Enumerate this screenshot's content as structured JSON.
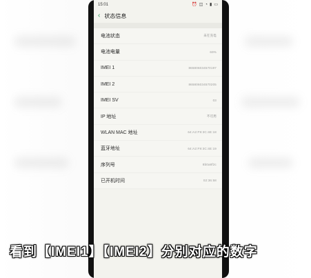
{
  "status_bar": {
    "time": "15:01",
    "icons": [
      "alarm-icon",
      "vibrate-icon",
      "wifi-icon",
      "signal-icon",
      "battery-icon"
    ]
  },
  "header": {
    "back": "‹",
    "title": "状态信息"
  },
  "items": [
    {
      "label": "电池状态",
      "value": "未在充电"
    },
    {
      "label": "电池电量",
      "value": "69%"
    },
    {
      "label": "IMEI 1",
      "value": "865806034570197"
    },
    {
      "label": "IMEI 2",
      "value": "865806034570205"
    },
    {
      "label": "IMEI SV",
      "value": "03"
    },
    {
      "label": "IP 地址",
      "value": "不可用"
    },
    {
      "label": "WLAN MAC 地址",
      "value": "64:A2:F9:3C:4E:18"
    },
    {
      "label": "蓝牙地址",
      "value": "64:A2:F9:3C:4E:19"
    },
    {
      "label": "序列号",
      "value": "8b0a8f2c"
    },
    {
      "label": "已开机时间",
      "value": "02:36:58"
    }
  ],
  "caption": "看到【IMEI1】【IMEI2】分别对应的数字",
  "colors": {
    "accent": "#2e9a5b",
    "screen_bg": "#f3f3ee",
    "caption_fill": "#ffffff"
  }
}
